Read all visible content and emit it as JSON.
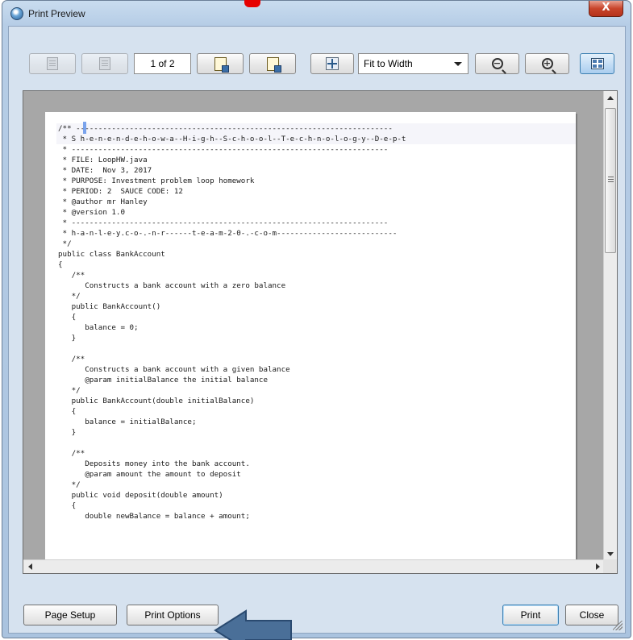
{
  "window": {
    "title": "Print Preview",
    "close_glyph": "X"
  },
  "toolbar": {
    "page_indicator": "1 of 2",
    "fit_mode": "Fit to Width",
    "zoom_out_glyph": "−",
    "zoom_in_glyph": "+"
  },
  "code_lines": [
    "/** -----------------------------------------------------------------------",
    " * S h-e-n-e-n-d-e-h-o-w-a--H-i-g-h--S-c-h-o-o-l--T-e-c-h-n-o-l-o-g-y--D-e-p-t",
    " * -----------------------------------------------------------------------",
    " * FILE: LoopHW.java",
    " * DATE:  Nov 3, 2017",
    " * PURPOSE: Investment problem loop homework",
    " * PERIOD: 2  SAUCE CODE: 12",
    " * @author mr Hanley",
    " * @version 1.0",
    " * -----------------------------------------------------------------------",
    " * h-a-n-l-e-y.c-o-.-n-r------t-e-a-m-2-0-.-c-o-m---------------------------",
    " */",
    "public class BankAccount",
    "{",
    "   /**",
    "      Constructs a bank account with a zero balance",
    "   */",
    "   public BankAccount()",
    "   {",
    "      balance = 0;",
    "   }",
    "",
    "   /**",
    "      Constructs a bank account with a given balance",
    "      @param initialBalance the initial balance",
    "   */",
    "   public BankAccount(double initialBalance)",
    "   {",
    "      balance = initialBalance;",
    "   }",
    "",
    "   /**",
    "      Deposits money into the bank account.",
    "      @param amount the amount to deposit",
    "   */",
    "   public void deposit(double amount)",
    "   {",
    "      double newBalance = balance + amount;"
  ],
  "buttons": {
    "page_setup": "Page Setup",
    "print_options": "Print Options",
    "print": "Print",
    "close": "Close"
  },
  "colors": {
    "annotation_arrow": "#4a6f98",
    "annotation_arrow_border": "#2a4a70",
    "title_accent": "#e60000"
  }
}
